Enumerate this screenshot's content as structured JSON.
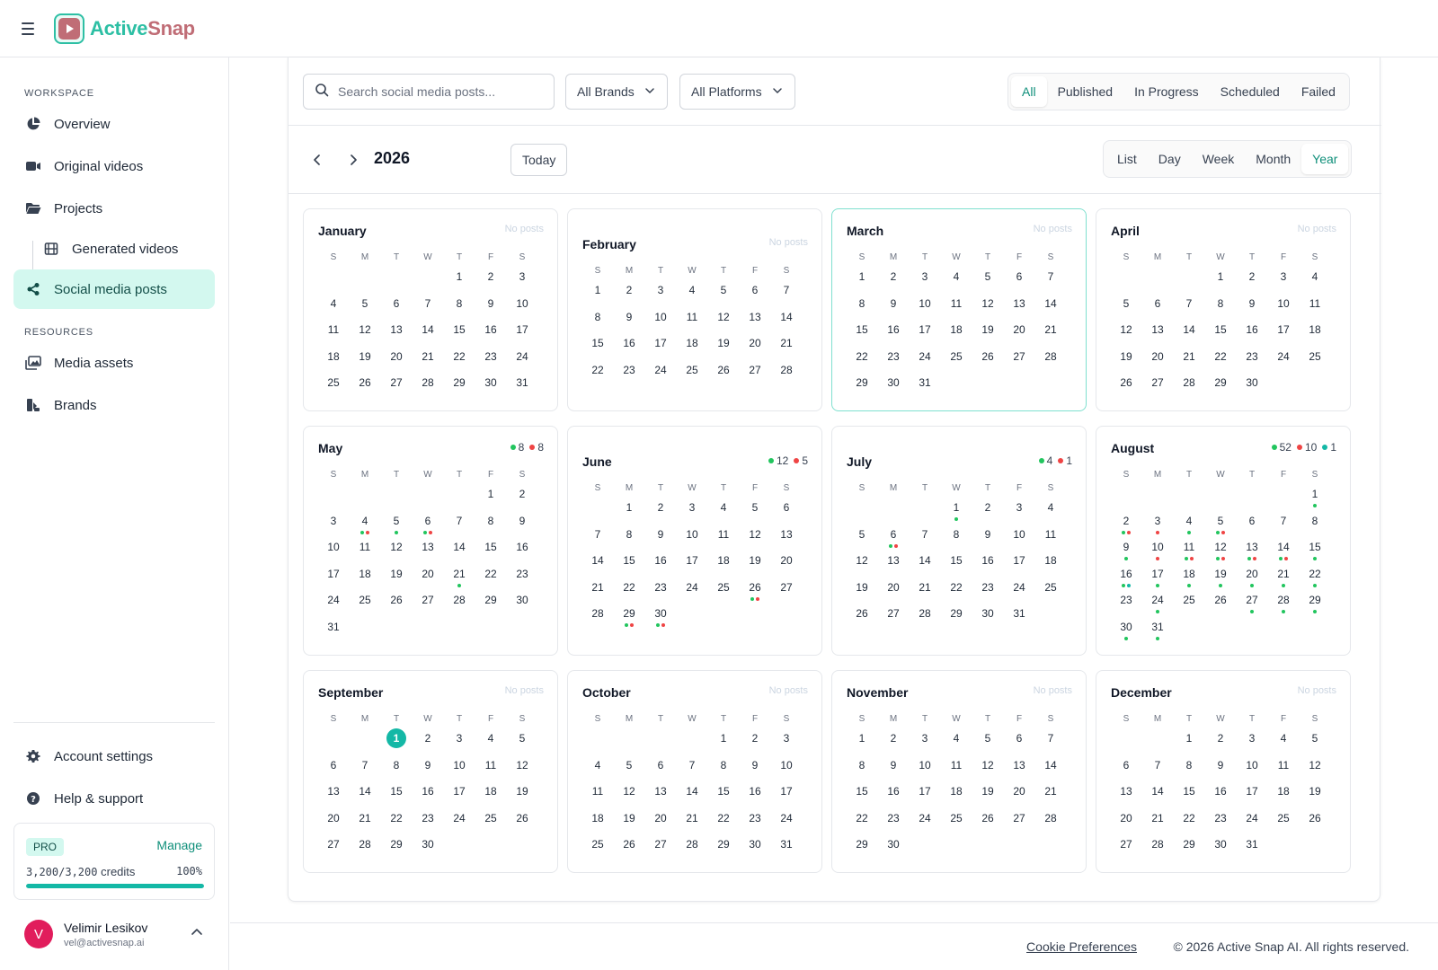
{
  "app": {
    "name_part1": "Active",
    "name_part2": "Snap"
  },
  "sidebar": {
    "workspace_label": "WORKSPACE",
    "resources_label": "RESOURCES",
    "items": [
      {
        "label": "Overview",
        "icon": "pie-chart-icon"
      },
      {
        "label": "Original videos",
        "icon": "video-camera-icon"
      },
      {
        "label": "Projects",
        "icon": "folder-icon"
      },
      {
        "label": "Generated videos",
        "icon": "film-icon"
      },
      {
        "label": "Social media posts",
        "icon": "share-icon"
      },
      {
        "label": "Media assets",
        "icon": "images-icon"
      },
      {
        "label": "Brands",
        "icon": "brand-icon"
      },
      {
        "label": "Account settings",
        "icon": "gear-icon"
      },
      {
        "label": "Help & support",
        "icon": "help-icon"
      }
    ],
    "plan": {
      "badge": "PRO",
      "manage_label": "Manage",
      "credits_used": "3,200",
      "credits_total": "3,200",
      "credits_word": "credits",
      "percent_label": "100%",
      "fill_fraction": 1.0
    },
    "user": {
      "initial": "V",
      "name": "Velimir Lesikov",
      "email": "vel@activesnap.ai"
    }
  },
  "filters": {
    "search_placeholder": "Search social media posts...",
    "brand_dropdown": "All Brands",
    "platform_dropdown": "All Platforms",
    "status_tabs": [
      "All",
      "Published",
      "In Progress",
      "Scheduled",
      "Failed"
    ],
    "active_status": "All"
  },
  "calendar": {
    "year": "2026",
    "today_label": "Today",
    "views": [
      "List",
      "Day",
      "Week",
      "Month",
      "Year"
    ],
    "active_view": "Year",
    "no_posts_label": "No posts",
    "weekday_letters": [
      "S",
      "M",
      "T",
      "W",
      "T",
      "F",
      "S"
    ],
    "months": [
      {
        "name": "January",
        "start": 4,
        "days": 31,
        "stats": null,
        "dots": {}
      },
      {
        "name": "February",
        "start": 0,
        "days": 28,
        "stats": null,
        "dots": {}
      },
      {
        "name": "March",
        "start": 0,
        "days": 31,
        "stats": null,
        "dots": {},
        "current": true
      },
      {
        "name": "April",
        "start": 3,
        "days": 30,
        "stats": null,
        "dots": {}
      },
      {
        "name": "May",
        "start": 5,
        "days": 31,
        "stats": [
          [
            "g",
            "8"
          ],
          [
            "r",
            "8"
          ]
        ],
        "dots": {
          "4": [
            "g",
            "r"
          ],
          "5": [
            "g"
          ],
          "6": [
            "g",
            "r"
          ],
          "21": [
            "g"
          ]
        }
      },
      {
        "name": "June",
        "start": 1,
        "days": 30,
        "stats": [
          [
            "g",
            "12"
          ],
          [
            "r",
            "5"
          ]
        ],
        "dots": {
          "26": [
            "g",
            "r"
          ],
          "29": [
            "g",
            "r"
          ],
          "30": [
            "g",
            "r"
          ]
        }
      },
      {
        "name": "July",
        "start": 3,
        "days": 31,
        "stats": [
          [
            "g",
            "4"
          ],
          [
            "r",
            "1"
          ]
        ],
        "dots": {
          "1": [
            "g"
          ],
          "6": [
            "g",
            "r"
          ]
        }
      },
      {
        "name": "August",
        "start": 6,
        "days": 31,
        "stats": [
          [
            "g",
            "52"
          ],
          [
            "r",
            "10"
          ],
          [
            "t",
            "1"
          ]
        ],
        "dots": {
          "1": [
            "g"
          ],
          "2": [
            "g",
            "r"
          ],
          "3": [
            "r"
          ],
          "4": [
            "g"
          ],
          "5": [
            "g",
            "r"
          ],
          "9": [
            "g"
          ],
          "10": [
            "r"
          ],
          "11": [
            "g",
            "r"
          ],
          "12": [
            "g",
            "r"
          ],
          "13": [
            "g",
            "r"
          ],
          "14": [
            "g",
            "r"
          ],
          "15": [
            "g"
          ],
          "16": [
            "g",
            "t"
          ],
          "17": [
            "g"
          ],
          "18": [
            "g"
          ],
          "19": [
            "g"
          ],
          "20": [
            "g"
          ],
          "21": [
            "g"
          ],
          "22": [
            "g"
          ],
          "24": [
            "g"
          ],
          "27": [
            "g"
          ],
          "28": [
            "g"
          ],
          "29": [
            "g"
          ],
          "30": [
            "g"
          ],
          "31": [
            "g"
          ]
        }
      },
      {
        "name": "September",
        "start": 2,
        "days": 30,
        "stats": null,
        "dots": {},
        "today": 1
      },
      {
        "name": "October",
        "start": 4,
        "days": 31,
        "stats": null,
        "dots": {}
      },
      {
        "name": "November",
        "start": 0,
        "days": 30,
        "stats": null,
        "dots": {}
      },
      {
        "name": "December",
        "start": 2,
        "days": 31,
        "stats": null,
        "dots": {}
      }
    ]
  },
  "footer": {
    "cookie_label": "Cookie Preferences",
    "copyright": "© 2026 Active Snap AI. All rights reserved."
  },
  "colors": {
    "accent": "#14b8a6",
    "active_nav_bg": "#d3f8ef",
    "published_dot": "#22c55e",
    "failed_dot": "#ef4444",
    "scheduled_dot": "#14b8a6"
  }
}
